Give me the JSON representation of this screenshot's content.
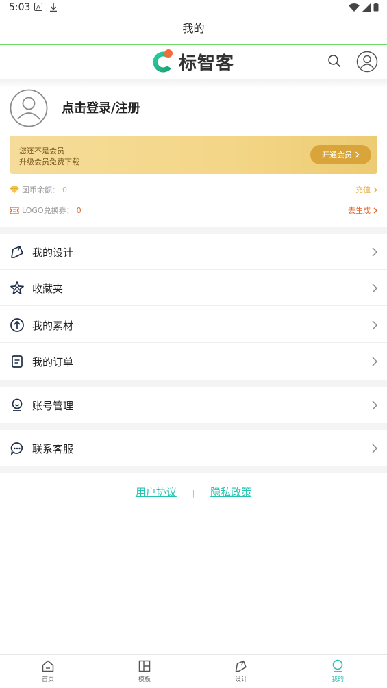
{
  "status_bar": {
    "time": "5:03",
    "left_icons": [
      "notification-a-icon",
      "download-icon"
    ],
    "right_icons": [
      "wifi-icon",
      "signal-icon",
      "battery-icon"
    ]
  },
  "title_bar": {
    "title": "我的"
  },
  "app_header": {
    "logo_text": "标智客",
    "search_icon": "search-icon",
    "avatar_icon": "user-avatar-icon"
  },
  "profile": {
    "login_text": "点击登录/注册"
  },
  "vip": {
    "line1": "您还不是会员",
    "line2": "升级会员免费下载",
    "button": "开通会员",
    "colors": {
      "card": "#f3d687",
      "button": "#d9a43a"
    }
  },
  "stats": {
    "coins": {
      "label": "图币余额：",
      "value": "0",
      "action": "充值"
    },
    "logo_voucher": {
      "label": "LOGO兑换券：",
      "value": "0",
      "action": "去生成"
    }
  },
  "menu": {
    "group1": [
      {
        "label": "我的设计",
        "icon": "design-pen-icon"
      },
      {
        "label": "收藏夹",
        "icon": "favorite-star-icon"
      },
      {
        "label": "我的素材",
        "icon": "upload-circle-icon"
      },
      {
        "label": "我的订单",
        "icon": "order-document-icon"
      }
    ],
    "group2": [
      {
        "label": "账号管理",
        "icon": "account-icon"
      }
    ],
    "group3": [
      {
        "label": "联系客服",
        "icon": "chat-bubble-icon"
      }
    ]
  },
  "footer": {
    "user_agreement": "用户协议",
    "separator": "|",
    "privacy_policy": "隐私政策"
  },
  "bottom_nav": {
    "items": [
      {
        "label": "首页",
        "icon": "home-icon",
        "active": false
      },
      {
        "label": "模板",
        "icon": "template-grid-icon",
        "active": false
      },
      {
        "label": "设计",
        "icon": "design-pen-icon",
        "active": false
      },
      {
        "label": "我的",
        "icon": "profile-icon",
        "active": true
      }
    ],
    "accent_color": "#1fc3b2"
  }
}
